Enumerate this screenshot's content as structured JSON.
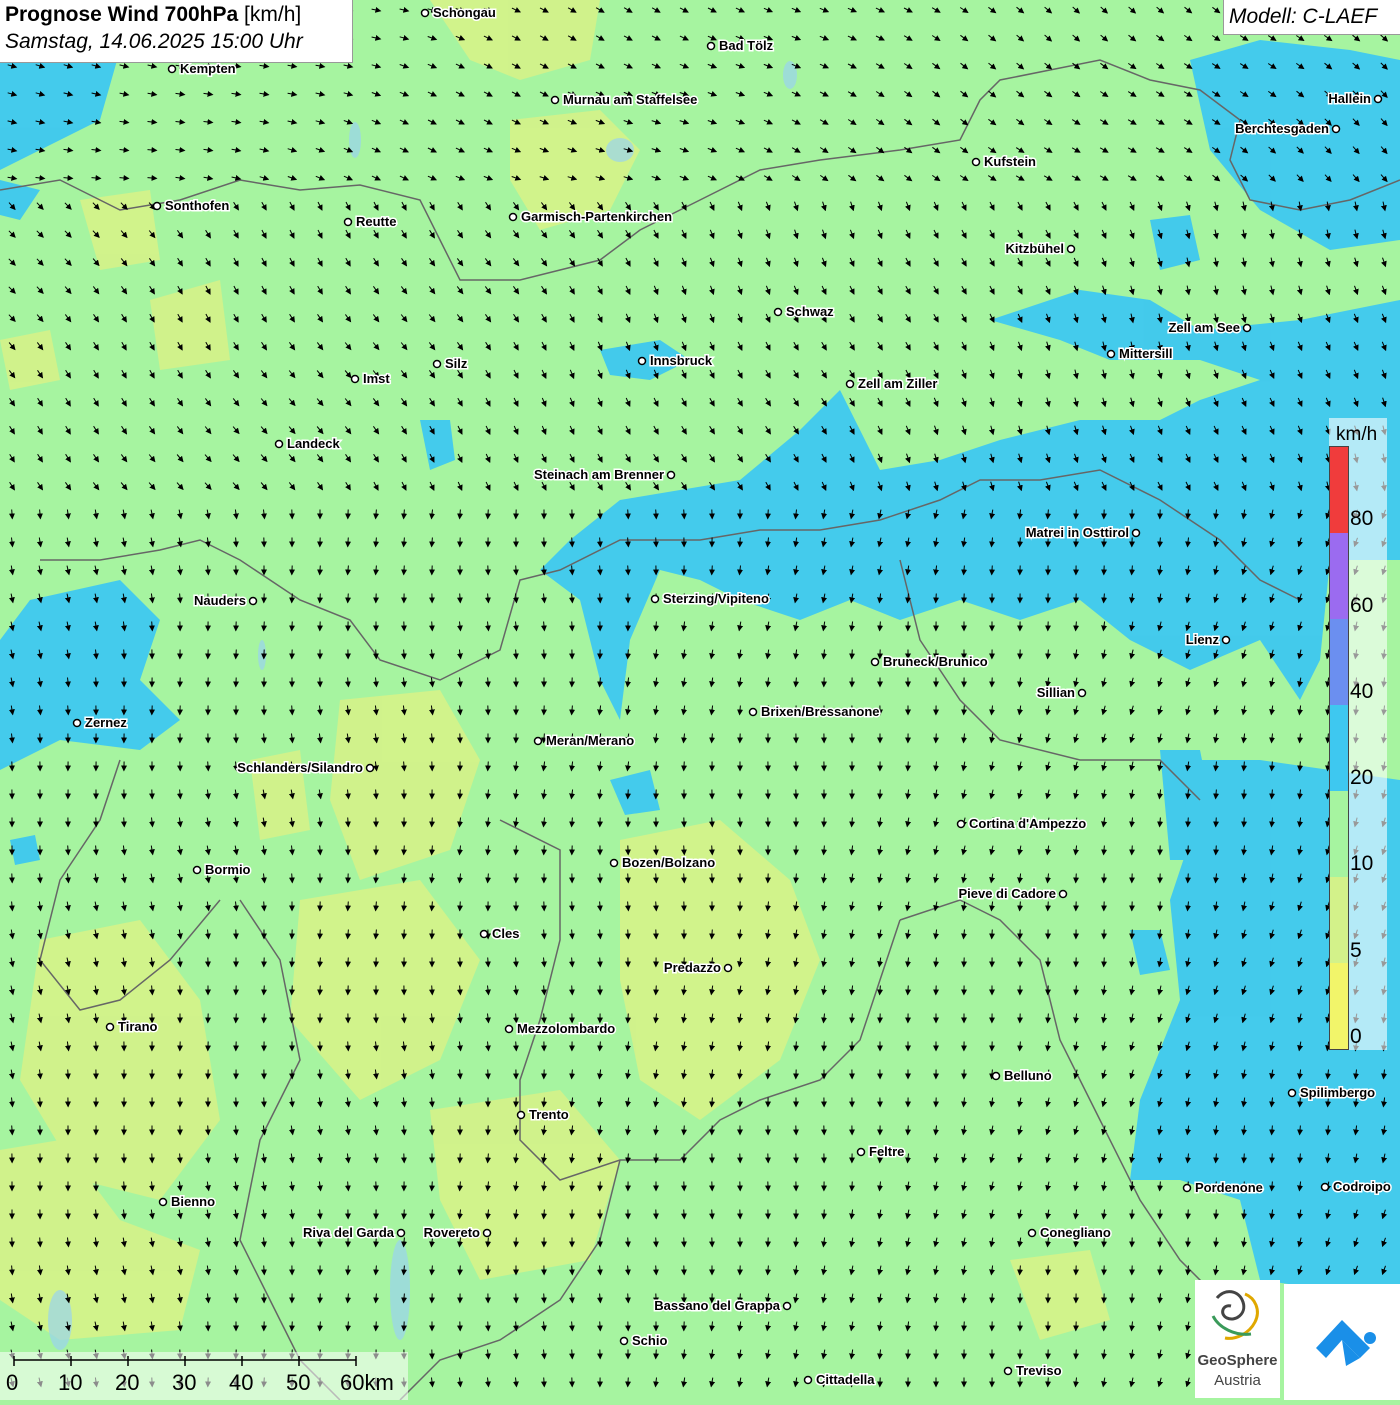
{
  "header": {
    "title_bold": "Prognose Wind 700hPa",
    "title_unit": "[km/h]",
    "datetime": "Samstag, 14.06.2025 15:00 Uhr",
    "model": "Modell: C-LAEF"
  },
  "colors": {
    "ws_0_5": "#f2f56a",
    "ws_5_10": "#d3f28a",
    "ws_10_20": "#a6f4a0",
    "ws_20_40": "#3ec8f0",
    "ws_40_60": "#6b8ff0",
    "ws_60_80": "#9b6bf0",
    "ws_80_plus": "#f03c3c",
    "border": "#666666"
  },
  "legend": {
    "unit": "km/h",
    "ticks": [
      "80",
      "60",
      "40",
      "20",
      "10",
      "5",
      "0"
    ]
  },
  "scalebar": {
    "labels": [
      "0",
      "10",
      "20",
      "30",
      "40",
      "50",
      "60km"
    ]
  },
  "cities": [
    {
      "name": "Schongau"
    },
    {
      "name": "Bad Tölz"
    },
    {
      "name": "Kempten"
    },
    {
      "name": "Murnau am Staffelsee"
    },
    {
      "name": "Hallein"
    },
    {
      "name": "Berchtesgaden"
    },
    {
      "name": "Kufstein"
    },
    {
      "name": "Sonthofen"
    },
    {
      "name": "Reutte"
    },
    {
      "name": "Garmisch-Partenkirchen"
    },
    {
      "name": "Kitzbühel"
    },
    {
      "name": "Schwaz"
    },
    {
      "name": "Zell am See"
    },
    {
      "name": "Innsbruck"
    },
    {
      "name": "Mittersill"
    },
    {
      "name": "Silz"
    },
    {
      "name": "Imst"
    },
    {
      "name": "Zell am Ziller"
    },
    {
      "name": "Landeck"
    },
    {
      "name": "Steinach am Brenner"
    },
    {
      "name": "Matrei in Osttirol"
    },
    {
      "name": "Nauders"
    },
    {
      "name": "Sterzing/Vipiteno"
    },
    {
      "name": "Lienz"
    },
    {
      "name": "Bruneck/Brunico"
    },
    {
      "name": "Sillian"
    },
    {
      "name": "Brixen/Bressanone"
    },
    {
      "name": "Zernez"
    },
    {
      "name": "Meran/Merano"
    },
    {
      "name": "Schlanders/Silandro"
    },
    {
      "name": "Cortina d'Ampezzo"
    },
    {
      "name": "Bozen/Bolzano"
    },
    {
      "name": "Bormio"
    },
    {
      "name": "Pieve di Cadore"
    },
    {
      "name": "Cles"
    },
    {
      "name": "Predazzo"
    },
    {
      "name": "Tirano"
    },
    {
      "name": "Mezzolombardo"
    },
    {
      "name": "Belluno"
    },
    {
      "name": "Spilimbergo"
    },
    {
      "name": "Trento"
    },
    {
      "name": "Feltre"
    },
    {
      "name": "Pordenone"
    },
    {
      "name": "Codroipo"
    },
    {
      "name": "Bienno"
    },
    {
      "name": "Riva del Garda"
    },
    {
      "name": "Rovereto"
    },
    {
      "name": "Conegliano"
    },
    {
      "name": "Bassano del Grappa"
    },
    {
      "name": "Schio"
    },
    {
      "name": "Treviso"
    },
    {
      "name": "Cittadella"
    }
  ],
  "logo": {
    "line1": "GeoSphere",
    "line2": "Austria"
  }
}
